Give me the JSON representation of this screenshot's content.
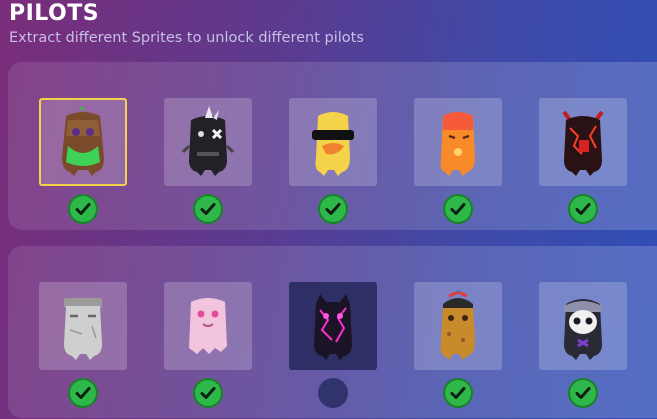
{
  "header": {
    "title": "PILOTS",
    "subtitle": "Extract different Sprites to unlock different pilots"
  },
  "pilots": [
    {
      "row": 1,
      "icon": "wooden-sprite-icon",
      "unlocked": true,
      "selected": true
    },
    {
      "row": 1,
      "icon": "punk-sprite-icon",
      "unlocked": true,
      "selected": false
    },
    {
      "row": 1,
      "icon": "cool-duck-sprite-icon",
      "unlocked": true,
      "selected": false
    },
    {
      "row": 1,
      "icon": "orange-sprite-icon",
      "unlocked": true,
      "selected": false
    },
    {
      "row": 1,
      "icon": "lava-demon-sprite-icon",
      "unlocked": true,
      "selected": false
    },
    {
      "row": 2,
      "icon": "stone-sprite-icon",
      "unlocked": true,
      "selected": false
    },
    {
      "row": 2,
      "icon": "pink-ghost-sprite-icon",
      "unlocked": true,
      "selected": false
    },
    {
      "row": 2,
      "icon": "neon-cat-sprite-icon",
      "unlocked": false,
      "selected": false
    },
    {
      "row": 2,
      "icon": "propeller-hat-sprite-icon",
      "unlocked": true,
      "selected": false
    },
    {
      "row": 2,
      "icon": "skull-sprite-icon",
      "unlocked": true,
      "selected": false
    }
  ],
  "colors": {
    "selected_border": "#f3d34a",
    "check_green": "#2eb84a",
    "locked_tile": "#2e2f66"
  }
}
